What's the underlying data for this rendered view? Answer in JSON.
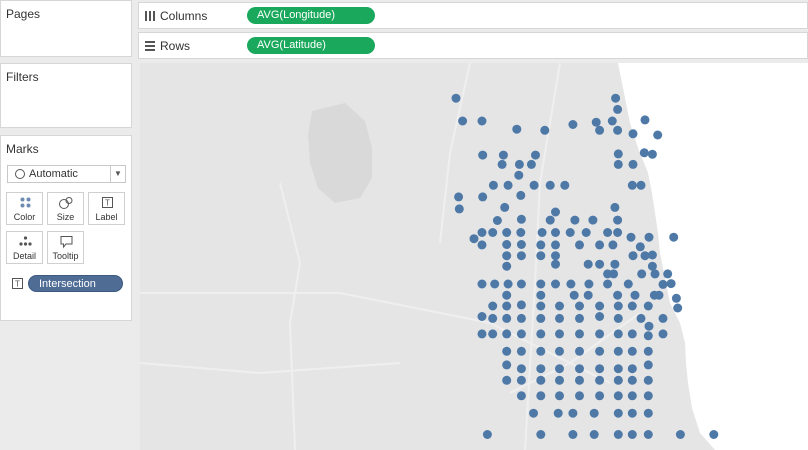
{
  "panels": {
    "pages": {
      "title": "Pages"
    },
    "filters": {
      "title": "Filters"
    },
    "marks": {
      "title": "Marks",
      "mark_type": "Automatic",
      "buttons": [
        {
          "label": "Color",
          "icon": "color-dots-icon"
        },
        {
          "label": "Size",
          "icon": "size-circles-icon"
        },
        {
          "label": "Label",
          "icon": "label-box-icon"
        },
        {
          "label": "Detail",
          "icon": "detail-dots-icon"
        },
        {
          "label": "Tooltip",
          "icon": "tooltip-bubble-icon"
        }
      ],
      "field_pill": {
        "label": "Intersection",
        "icon": "label-box-icon"
      }
    }
  },
  "shelves": {
    "columns": {
      "label": "Columns",
      "icon": "columns-icon",
      "pill": "AVG(Longitude)"
    },
    "rows": {
      "label": "Rows",
      "icon": "rows-icon",
      "pill": "AVG(Latitude)"
    }
  },
  "colors": {
    "pill_green": "#1aa85c",
    "pill_blue": "#4f6c95",
    "mark": "#4e79a7",
    "map_land": "#e5e5e5",
    "map_water": "#ffffff"
  },
  "map_points": [
    [
      0.473,
      0.091
    ],
    [
      0.483,
      0.15
    ],
    [
      0.512,
      0.15
    ],
    [
      0.564,
      0.171
    ],
    [
      0.606,
      0.174
    ],
    [
      0.648,
      0.159
    ],
    [
      0.683,
      0.153
    ],
    [
      0.707,
      0.15
    ],
    [
      0.712,
      0.091
    ],
    [
      0.715,
      0.12
    ],
    [
      0.688,
      0.174
    ],
    [
      0.715,
      0.174
    ],
    [
      0.738,
      0.183
    ],
    [
      0.756,
      0.147
    ],
    [
      0.775,
      0.186
    ],
    [
      0.767,
      0.236
    ],
    [
      0.755,
      0.232
    ],
    [
      0.738,
      0.262
    ],
    [
      0.716,
      0.235
    ],
    [
      0.716,
      0.262
    ],
    [
      0.75,
      0.316
    ],
    [
      0.737,
      0.316
    ],
    [
      0.513,
      0.238
    ],
    [
      0.544,
      0.238
    ],
    [
      0.542,
      0.262
    ],
    [
      0.568,
      0.262
    ],
    [
      0.586,
      0.262
    ],
    [
      0.592,
      0.238
    ],
    [
      0.567,
      0.29
    ],
    [
      0.59,
      0.316
    ],
    [
      0.614,
      0.316
    ],
    [
      0.636,
      0.316
    ],
    [
      0.529,
      0.316
    ],
    [
      0.551,
      0.316
    ],
    [
      0.57,
      0.342
    ],
    [
      0.477,
      0.346
    ],
    [
      0.478,
      0.377
    ],
    [
      0.513,
      0.346
    ],
    [
      0.546,
      0.373
    ],
    [
      0.535,
      0.407
    ],
    [
      0.571,
      0.404
    ],
    [
      0.512,
      0.438
    ],
    [
      0.528,
      0.438
    ],
    [
      0.549,
      0.438
    ],
    [
      0.57,
      0.438
    ],
    [
      0.602,
      0.438
    ],
    [
      0.622,
      0.438
    ],
    [
      0.644,
      0.438
    ],
    [
      0.668,
      0.438
    ],
    [
      0.7,
      0.438
    ],
    [
      0.715,
      0.406
    ],
    [
      0.715,
      0.438
    ],
    [
      0.614,
      0.406
    ],
    [
      0.622,
      0.385
    ],
    [
      0.651,
      0.406
    ],
    [
      0.678,
      0.406
    ],
    [
      0.711,
      0.373
    ],
    [
      0.5,
      0.454
    ],
    [
      0.512,
      0.47
    ],
    [
      0.549,
      0.469
    ],
    [
      0.571,
      0.469
    ],
    [
      0.6,
      0.47
    ],
    [
      0.622,
      0.47
    ],
    [
      0.658,
      0.47
    ],
    [
      0.688,
      0.47
    ],
    [
      0.708,
      0.47
    ],
    [
      0.735,
      0.45
    ],
    [
      0.749,
      0.475
    ],
    [
      0.762,
      0.45
    ],
    [
      0.756,
      0.498
    ],
    [
      0.738,
      0.498
    ],
    [
      0.711,
      0.52
    ],
    [
      0.688,
      0.52
    ],
    [
      0.671,
      0.52
    ],
    [
      0.622,
      0.52
    ],
    [
      0.622,
      0.498
    ],
    [
      0.6,
      0.498
    ],
    [
      0.571,
      0.498
    ],
    [
      0.549,
      0.498
    ],
    [
      0.549,
      0.525
    ],
    [
      0.767,
      0.496
    ],
    [
      0.799,
      0.45
    ],
    [
      0.767,
      0.525
    ],
    [
      0.7,
      0.545
    ],
    [
      0.709,
      0.545
    ],
    [
      0.751,
      0.545
    ],
    [
      0.771,
      0.545
    ],
    [
      0.79,
      0.545
    ],
    [
      0.783,
      0.572
    ],
    [
      0.777,
      0.6
    ],
    [
      0.795,
      0.57
    ],
    [
      0.731,
      0.571
    ],
    [
      0.7,
      0.571
    ],
    [
      0.672,
      0.571
    ],
    [
      0.645,
      0.571
    ],
    [
      0.622,
      0.571
    ],
    [
      0.6,
      0.571
    ],
    [
      0.571,
      0.571
    ],
    [
      0.551,
      0.571
    ],
    [
      0.531,
      0.571
    ],
    [
      0.512,
      0.571
    ],
    [
      0.549,
      0.6
    ],
    [
      0.6,
      0.6
    ],
    [
      0.65,
      0.6
    ],
    [
      0.671,
      0.6
    ],
    [
      0.715,
      0.6
    ],
    [
      0.741,
      0.6
    ],
    [
      0.77,
      0.6
    ],
    [
      0.803,
      0.608
    ],
    [
      0.805,
      0.633
    ],
    [
      0.528,
      0.628
    ],
    [
      0.549,
      0.628
    ],
    [
      0.571,
      0.625
    ],
    [
      0.6,
      0.628
    ],
    [
      0.628,
      0.628
    ],
    [
      0.658,
      0.628
    ],
    [
      0.688,
      0.628
    ],
    [
      0.716,
      0.628
    ],
    [
      0.737,
      0.628
    ],
    [
      0.761,
      0.628
    ],
    [
      0.783,
      0.66
    ],
    [
      0.762,
      0.68
    ],
    [
      0.75,
      0.66
    ],
    [
      0.716,
      0.66
    ],
    [
      0.688,
      0.655
    ],
    [
      0.658,
      0.66
    ],
    [
      0.628,
      0.66
    ],
    [
      0.6,
      0.66
    ],
    [
      0.571,
      0.66
    ],
    [
      0.549,
      0.66
    ],
    [
      0.528,
      0.66
    ],
    [
      0.512,
      0.655
    ],
    [
      0.512,
      0.7
    ],
    [
      0.528,
      0.7
    ],
    [
      0.549,
      0.7
    ],
    [
      0.571,
      0.7
    ],
    [
      0.6,
      0.7
    ],
    [
      0.628,
      0.7
    ],
    [
      0.658,
      0.7
    ],
    [
      0.688,
      0.7
    ],
    [
      0.716,
      0.7
    ],
    [
      0.737,
      0.7
    ],
    [
      0.761,
      0.705
    ],
    [
      0.783,
      0.7
    ],
    [
      0.549,
      0.745
    ],
    [
      0.571,
      0.745
    ],
    [
      0.6,
      0.745
    ],
    [
      0.628,
      0.745
    ],
    [
      0.658,
      0.745
    ],
    [
      0.688,
      0.745
    ],
    [
      0.716,
      0.745
    ],
    [
      0.737,
      0.745
    ],
    [
      0.761,
      0.745
    ],
    [
      0.549,
      0.78
    ],
    [
      0.571,
      0.79
    ],
    [
      0.6,
      0.79
    ],
    [
      0.628,
      0.79
    ],
    [
      0.658,
      0.79
    ],
    [
      0.688,
      0.79
    ],
    [
      0.716,
      0.79
    ],
    [
      0.737,
      0.79
    ],
    [
      0.761,
      0.78
    ],
    [
      0.549,
      0.82
    ],
    [
      0.571,
      0.82
    ],
    [
      0.6,
      0.82
    ],
    [
      0.628,
      0.82
    ],
    [
      0.658,
      0.82
    ],
    [
      0.688,
      0.82
    ],
    [
      0.716,
      0.82
    ],
    [
      0.737,
      0.82
    ],
    [
      0.761,
      0.82
    ],
    [
      0.571,
      0.86
    ],
    [
      0.6,
      0.86
    ],
    [
      0.628,
      0.86
    ],
    [
      0.658,
      0.86
    ],
    [
      0.688,
      0.86
    ],
    [
      0.716,
      0.86
    ],
    [
      0.737,
      0.86
    ],
    [
      0.761,
      0.86
    ],
    [
      0.589,
      0.905
    ],
    [
      0.626,
      0.905
    ],
    [
      0.648,
      0.905
    ],
    [
      0.68,
      0.905
    ],
    [
      0.716,
      0.905
    ],
    [
      0.737,
      0.905
    ],
    [
      0.761,
      0.905
    ],
    [
      0.52,
      0.96
    ],
    [
      0.6,
      0.96
    ],
    [
      0.648,
      0.96
    ],
    [
      0.68,
      0.96
    ],
    [
      0.716,
      0.96
    ],
    [
      0.737,
      0.96
    ],
    [
      0.761,
      0.96
    ],
    [
      0.809,
      0.96
    ],
    [
      0.859,
      0.96
    ]
  ]
}
